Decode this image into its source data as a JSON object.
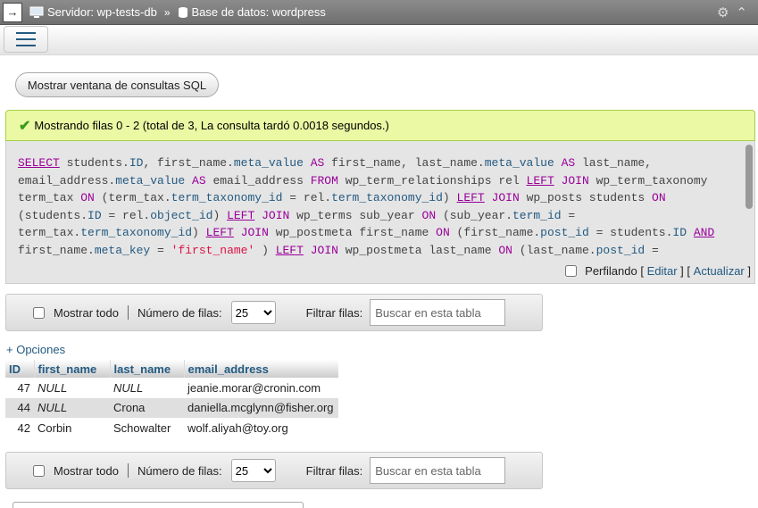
{
  "breadcrumb": {
    "server_label": "Servidor: wp-tests-db",
    "separator": "»",
    "database_label": "Base de datos: wordpress"
  },
  "icons": [
    "go-arrow-icon",
    "server-icon",
    "database-icon",
    "gear-icon",
    "collapse-icon",
    "hamburger-menu-icon",
    "check-icon"
  ],
  "sql_window_button": "Mostrar ventana de consultas SQL",
  "success_message": "Mostrando filas 0 - 2 (total de 3, La consulta tardó 0.0018 segundos.)",
  "sql_query": "SELECT students.ID, first_name.meta_value AS first_name, last_name.meta_value AS last_name, email_address.meta_value AS email_address FROM wp_term_relationships rel LEFT JOIN wp_term_taxonomy term_tax ON (term_tax.term_taxonomy_id = rel.term_taxonomy_id) LEFT JOIN wp_posts students ON (students.ID = rel.object_id) LEFT JOIN wp_terms sub_year ON (sub_year.term_id = term_tax.term_taxonomy_id) LEFT JOIN wp_postmeta first_name ON (first_name.post_id = students.ID AND first_name.meta_key = 'first_name' ) LEFT JOIN wp_postmeta last_name ON (last_name.post_id =",
  "profiling": {
    "label": "Perfilando",
    "bracket_open": "[",
    "bracket_close": "]",
    "edit_link": "Editar",
    "refresh_link": "Actualizar"
  },
  "navigation": {
    "show_all": "Mostrar todo",
    "rows_label": "Número de filas:",
    "rows_value": "25",
    "filter_label": "Filtrar filas:",
    "filter_placeholder": "Buscar en esta tabla"
  },
  "options_link": "+ Opciones",
  "table": {
    "columns": [
      "ID",
      "first_name",
      "last_name",
      "email_address"
    ],
    "rows": [
      [
        "47",
        "NULL",
        "NULL",
        "jeanie.morar@cronin.com"
      ],
      [
        "44",
        "NULL",
        "Crona",
        "daniella.mcglynn@fisher.org"
      ],
      [
        "42",
        "Corbin",
        "Schowalter",
        "wolf.aliyah@toy.org"
      ]
    ]
  }
}
